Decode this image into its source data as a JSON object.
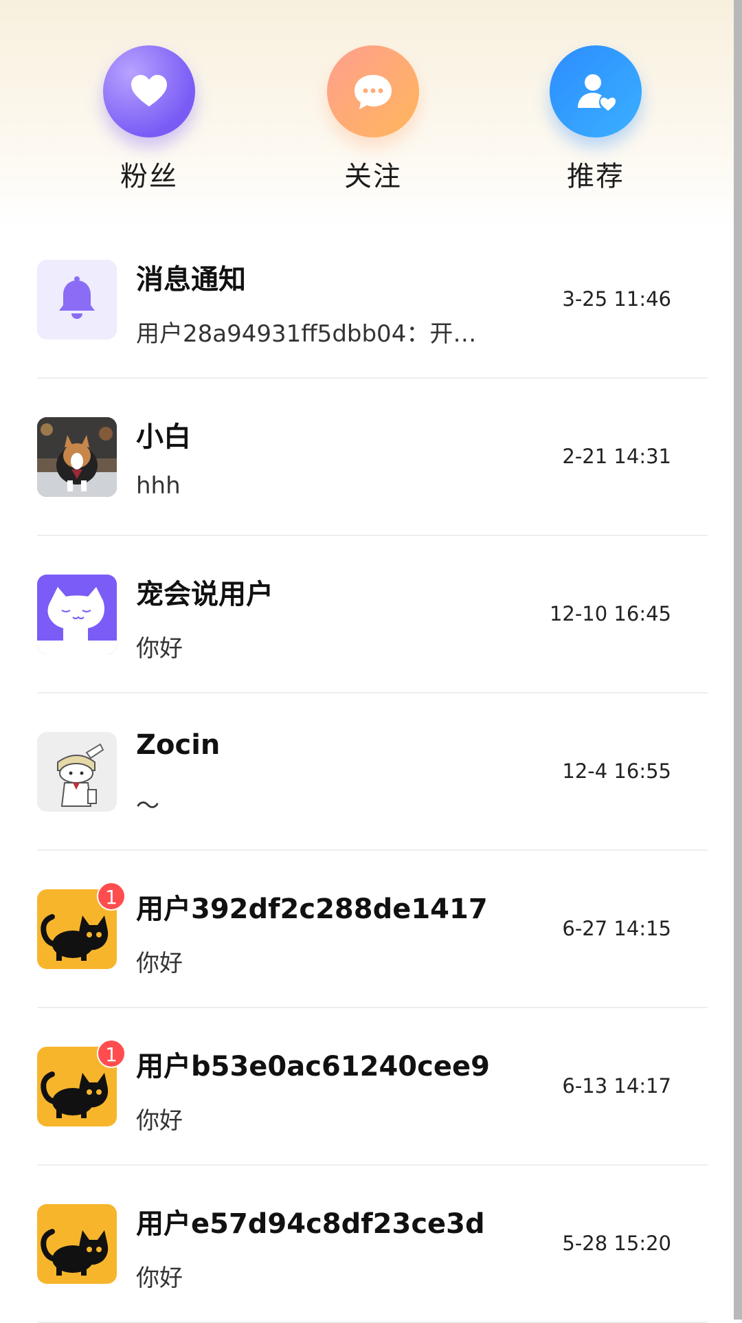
{
  "quick_actions": [
    {
      "label": "粉丝",
      "icon": "heart-icon"
    },
    {
      "label": "关注",
      "icon": "chat-bubble-icon"
    },
    {
      "label": "推荐",
      "icon": "user-heart-icon"
    }
  ],
  "conversations": [
    {
      "name": "消息通知",
      "preview": "用户28a94931ff5dbb04：开…",
      "time": "3-25 11:46",
      "avatar": "bell-icon",
      "badge": ""
    },
    {
      "name": "小白",
      "preview": "hhh",
      "time": "2-21 14:31",
      "avatar": "corgi-photo",
      "badge": ""
    },
    {
      "name": "宠会说用户",
      "preview": "你好",
      "time": "12-10 16:45",
      "avatar": "white-cat-avatar",
      "badge": ""
    },
    {
      "name": "Zocin",
      "preview": "～",
      "time": "12-4 16:55",
      "avatar": "rabbit-sketch-avatar",
      "badge": ""
    },
    {
      "name": "用户392df2c288de1417",
      "preview": "你好",
      "time": "6-27 14:15",
      "avatar": "black-cat-avatar",
      "badge": "1"
    },
    {
      "name": "用户b53e0ac61240cee9",
      "preview": "你好",
      "time": "6-13 14:17",
      "avatar": "black-cat-avatar",
      "badge": "1"
    },
    {
      "name": "用户e57d94c8df23ce3d",
      "preview": "你好",
      "time": "5-28 15:20",
      "avatar": "black-cat-avatar",
      "badge": ""
    }
  ],
  "colors": {
    "accent_purple": "#7a5cf5",
    "accent_orange": "#ffb65c",
    "accent_blue": "#2d8cff",
    "badge_red": "#ff4d4f",
    "cat_yellow": "#f7b52c"
  }
}
